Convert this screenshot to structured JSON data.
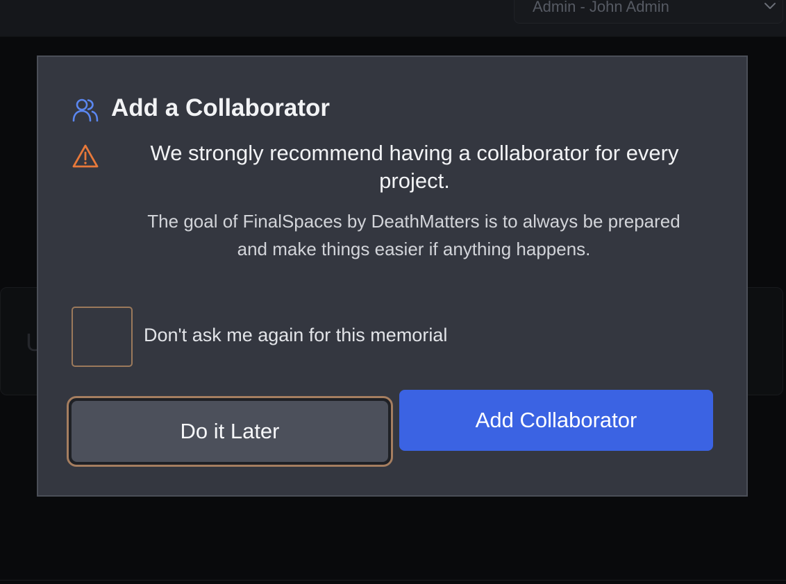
{
  "header": {
    "user_select_value": "Admin - John Admin"
  },
  "background": {
    "card_text": "U"
  },
  "modal": {
    "title": "Add a Collaborator",
    "warning": "We strongly recommend having a collaborator for every project.",
    "description": "The goal of FinalSpaces by DeathMatters is to always be prepared and make things easier if anything happens.",
    "checkbox_label": "Don't ask me again for this memorial",
    "checkbox_checked": false,
    "later_button_label": "Do it Later",
    "add_button_label": "Add Collaborator"
  },
  "icons": {
    "title": "users-icon",
    "warning": "warning-triangle-icon",
    "select": "chevron-down-icon"
  },
  "colors": {
    "accent_blue": "#3b63e3",
    "warning_orange": "#e8793a",
    "icon_blue": "#5b87f0",
    "focus_ring": "#a57e60",
    "modal_bg": "#343740"
  }
}
